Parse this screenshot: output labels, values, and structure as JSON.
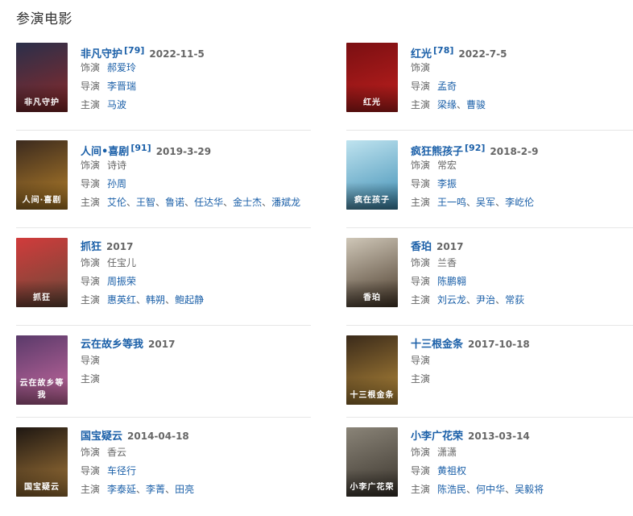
{
  "section_title": "参演电影",
  "labels": {
    "role": "饰演",
    "director": "导演",
    "cast": "主演"
  },
  "movies": [
    {
      "title": "非凡守护",
      "score": "[79]",
      "date": "2022-11-5",
      "role": "郝爱玲",
      "role_linked": true,
      "director": [
        "李晋瑞"
      ],
      "cast": [
        "马波"
      ],
      "poster_text": "非凡守护",
      "poster_colors": [
        "#2a2f4a",
        "#8c2a2a"
      ]
    },
    {
      "title": "红光",
      "score": "[78]",
      "date": "2022-7-5",
      "role": "",
      "role_linked": false,
      "director": [
        "孟奇"
      ],
      "cast": [
        "梁缘",
        "曹骏"
      ],
      "poster_text": "红光",
      "poster_colors": [
        "#7a0f12",
        "#c0201e"
      ]
    },
    {
      "title": "人间•喜剧",
      "score": "[91]",
      "date": "2019-3-29",
      "role": "诗诗",
      "role_linked": false,
      "director": [
        "孙周"
      ],
      "cast": [
        "艾伦",
        "王智",
        "鲁诺",
        "任达华",
        "金士杰",
        "潘斌龙"
      ],
      "poster_text": "人间·喜剧",
      "poster_colors": [
        "#3b2a1e",
        "#b8822a"
      ]
    },
    {
      "title": "疯狂熊孩子",
      "score": "[92]",
      "date": "2018-2-9",
      "role": "常宏",
      "role_linked": false,
      "director": [
        "李振"
      ],
      "cast": [
        "王一鸣",
        "吴军",
        "李屹伦"
      ],
      "poster_text": "疯在孩子",
      "poster_colors": [
        "#bfe3ef",
        "#3f8fb5"
      ]
    },
    {
      "title": "抓狂",
      "score": "",
      "date": "2017",
      "role": "任宝儿",
      "role_linked": false,
      "director": [
        "周振荣"
      ],
      "cast": [
        "惠英红",
        "韩朔",
        "鲍起静"
      ],
      "poster_text": "抓狂",
      "poster_colors": [
        "#d13b3b",
        "#6a4a3a"
      ]
    },
    {
      "title": "香珀",
      "score": "",
      "date": "2017",
      "role": "兰香",
      "role_linked": false,
      "director": [
        "陈鹏翱"
      ],
      "cast": [
        "刘云龙",
        "尹治",
        "常荻"
      ],
      "poster_text": "香珀",
      "poster_colors": [
        "#cfc7b8",
        "#4a3a2a"
      ]
    },
    {
      "title": "云在故乡等我",
      "score": "",
      "date": "2017",
      "role": "",
      "role_linked": false,
      "director": [],
      "cast": [],
      "poster_text": "云在故乡等我",
      "poster_colors": [
        "#5a3a6a",
        "#c86aa0"
      ]
    },
    {
      "title": "十三根金条",
      "score": "",
      "date": "2017-10-18",
      "role": "",
      "role_linked": false,
      "director": [],
      "cast": [],
      "poster_text": "十三根金条",
      "poster_colors": [
        "#3a2a1a",
        "#b58a3a"
      ]
    },
    {
      "title": "国宝疑云",
      "score": "",
      "date": "2014-04-18",
      "role": "香云",
      "role_linked": false,
      "director": [
        "车径行"
      ],
      "cast": [
        "李泰延",
        "李菁",
        "田亮"
      ],
      "poster_text": "国宝疑云",
      "poster_colors": [
        "#1e1712",
        "#a87a3a"
      ]
    },
    {
      "title": "小李广花荣",
      "score": "",
      "date": "2013-03-14",
      "role": "潇潇",
      "role_linked": false,
      "director": [
        "黄祖权"
      ],
      "cast": [
        "陈浩民",
        "何中华",
        "吴毅将"
      ],
      "poster_text": "小李广花荣",
      "poster_colors": [
        "#8a8478",
        "#3a342c"
      ]
    }
  ]
}
